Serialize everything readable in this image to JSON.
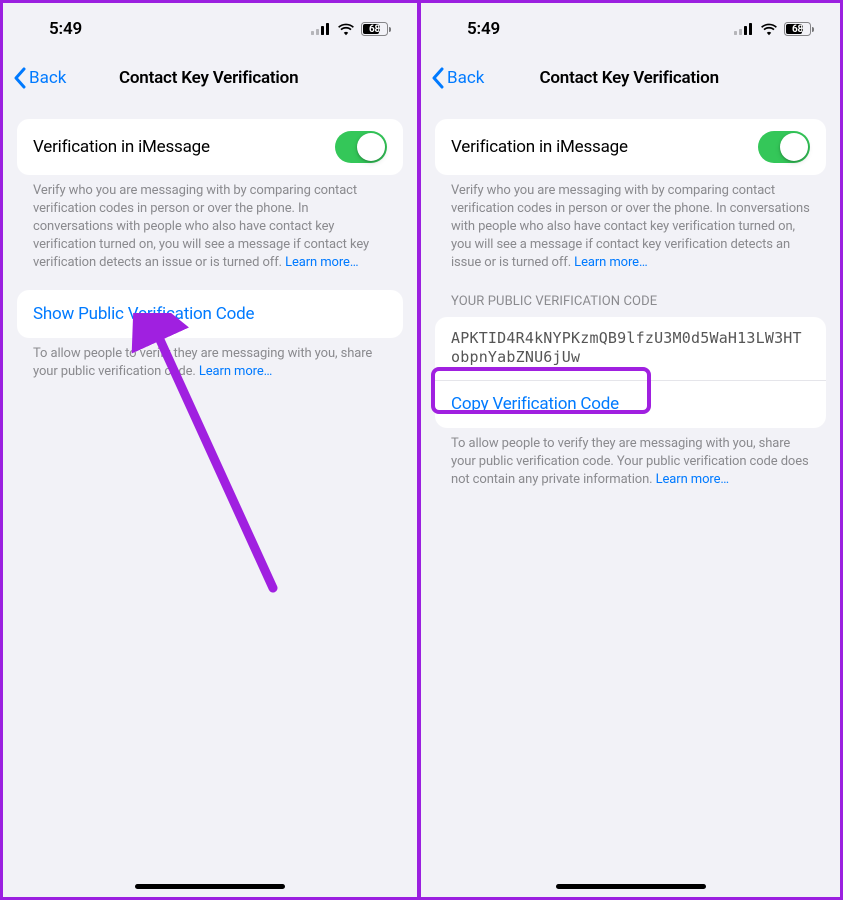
{
  "status": {
    "time": "5:49",
    "battery_pct": 68
  },
  "nav": {
    "back_label": "Back",
    "title": "Contact Key Verification"
  },
  "toggle_row": {
    "label": "Verification in iMessage",
    "on": true
  },
  "toggle_footer": "Verify who you are messaging with by comparing contact verification codes in person or over the phone. In conversations with people who also have contact key verification turned on, you will see a message if contact key verification detects an issue or is turned off.",
  "learn_more": "Learn more…",
  "left": {
    "show_code_label": "Show Public Verification Code",
    "allow_text": "To allow people to verify they are messaging with you, share your public verification code. "
  },
  "right": {
    "section_header": "YOUR PUBLIC VERIFICATION CODE",
    "code": "APKTID4R4kNYPKzmQB9lfzU3M0d5WaH13LW3HTobpnYabZNU6jUw",
    "copy_label": "Copy Verification Code",
    "allow_text": "To allow people to verify they are messaging with you, share your public verification code. Your public verification code does not contain any private information. "
  }
}
